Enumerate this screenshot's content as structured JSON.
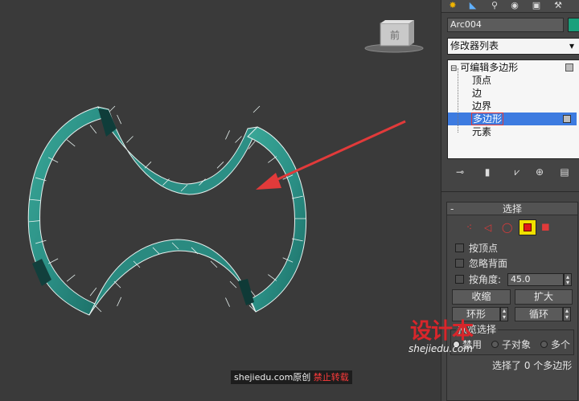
{
  "viewcube_label": "前",
  "panel": {
    "object_name": "Arc004",
    "object_color": "#1aa07c",
    "modifier_list_label": "修改器列表",
    "stack": {
      "root": "可编辑多边形",
      "items": [
        "顶点",
        "边",
        "边界",
        "多边形",
        "元素"
      ],
      "selected": "多边形"
    },
    "selection_rollout": {
      "title": "选择",
      "collapse_symbol": "-",
      "by_vertex": "按顶点",
      "ignore_backfacing": "忽略背面",
      "by_angle": "按角度:",
      "angle_value": "45.0",
      "shrink": "收缩",
      "grow": "扩大",
      "ring": "环形",
      "loop": "循环",
      "preview_label": "预览选择",
      "preview_options": [
        "禁用",
        "子对象",
        "多个"
      ],
      "preview_selected": "禁用",
      "status": "选择了 0 个多边形"
    }
  },
  "watermark": {
    "logo": "设计本",
    "url": "shejiedu.com"
  },
  "credit": {
    "site": "shejiedu.com",
    "original": "原创",
    "forbid": "禁止转载"
  },
  "colors": {
    "viewport_bg": "#3a3a3a",
    "mesh_face": "#2e9a8e",
    "mesh_edge": "#e6f0ee",
    "arrow": "#e23a3a",
    "selection_blue": "#3d7be0",
    "active_button": "#f0e000"
  }
}
